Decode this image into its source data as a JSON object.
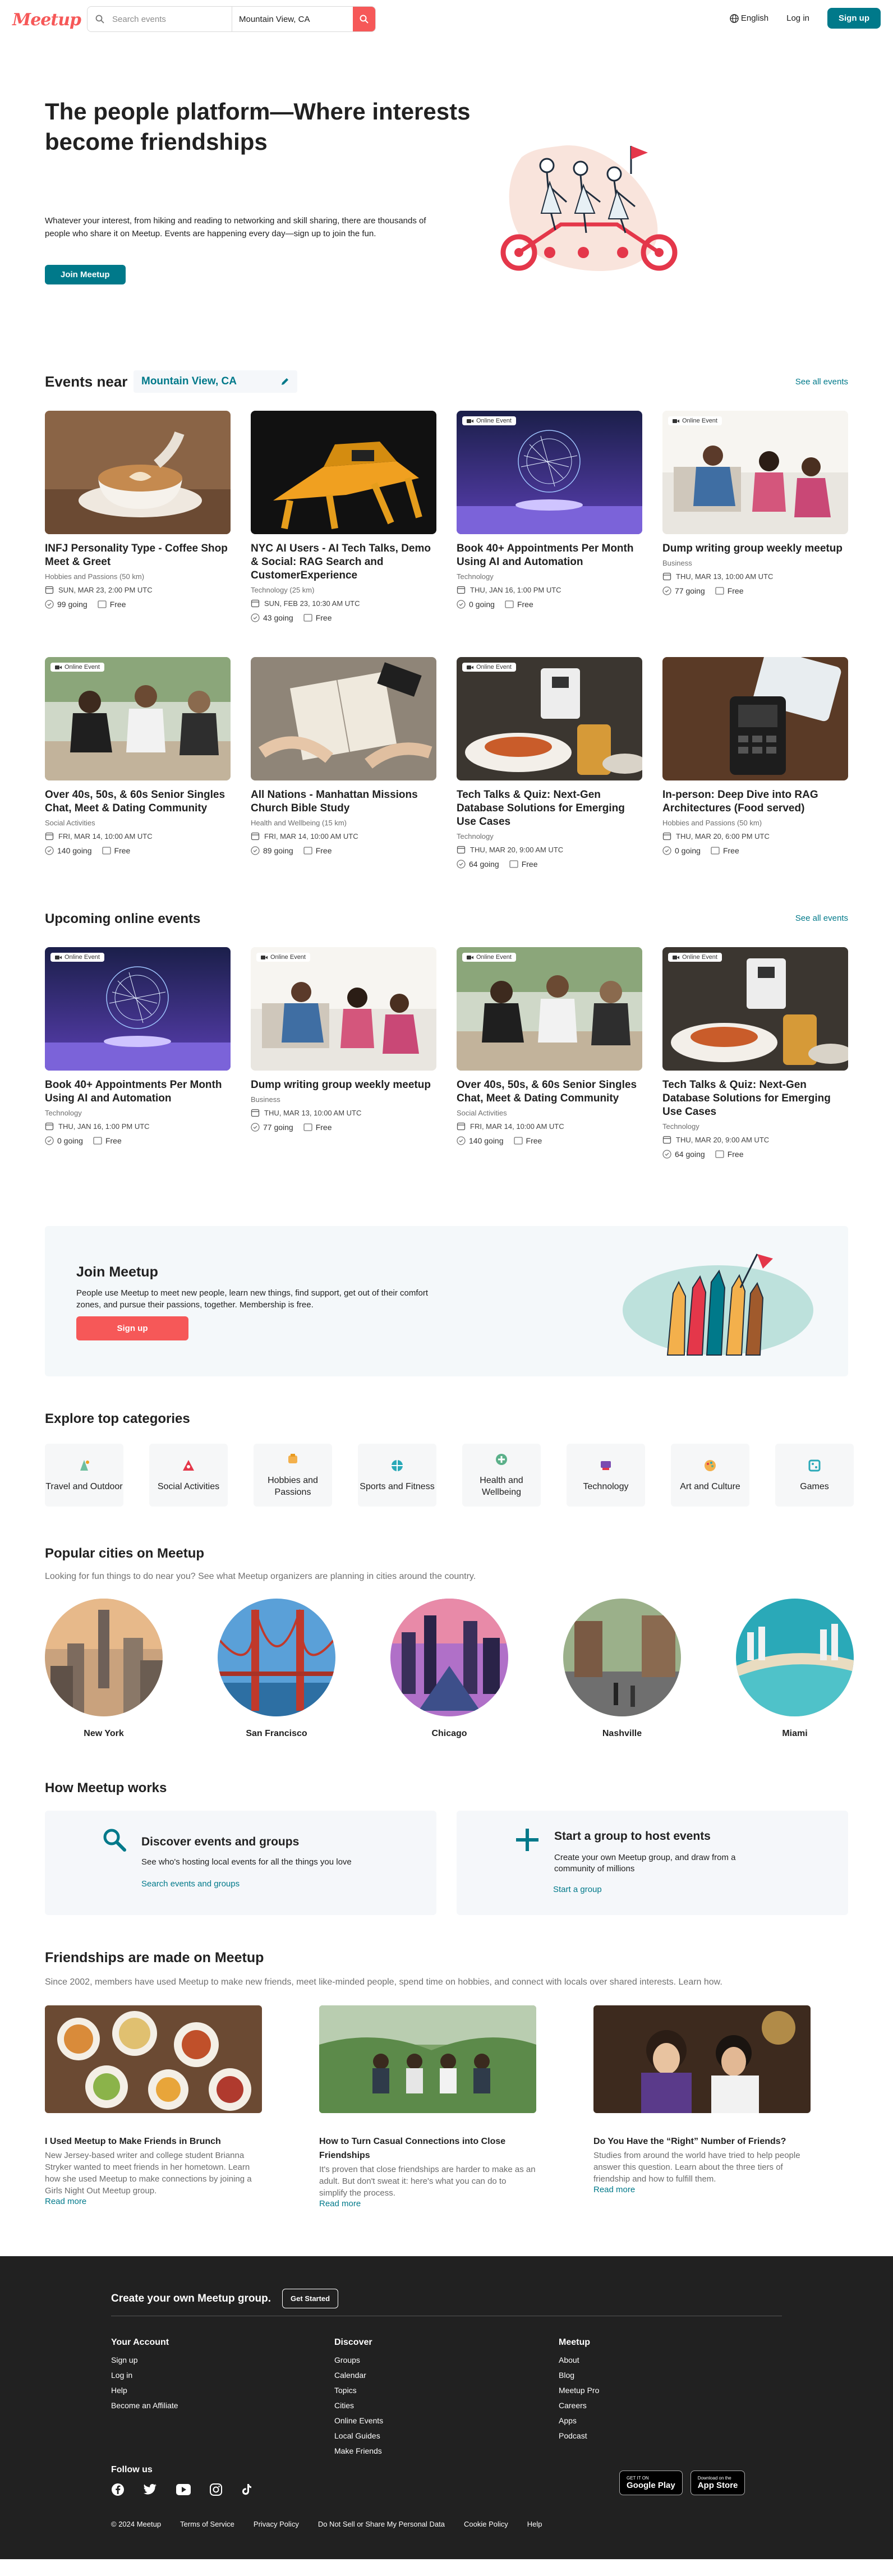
{
  "brand": {
    "logo": "Meetup",
    "accent": "#f65858",
    "teal": "#00798a"
  },
  "header": {
    "search_placeholder": "Search events",
    "location": "Mountain View, CA",
    "language": "English",
    "login": "Log in",
    "signup": "Sign up"
  },
  "hero": {
    "title": "The people platform—Where interests become friendships",
    "body": "Whatever your interest, from hiking and reading to networking and skill sharing, there are thousands of people who share it on Meetup. Events are happening every day—sign up to join the fun.",
    "cta": "Join Meetup"
  },
  "events_near": {
    "title": "Events near",
    "location": "Mountain View, CA",
    "see_all": "See all events",
    "online_badge": "Online Event",
    "items": [
      {
        "title": "INFJ Personality Type - Coffee Shop Meet & Greet",
        "group": "Hobbies and Passions (50 km)",
        "when": "SUN, MAR 23, 2:00 PM UTC",
        "going": "99 going",
        "price": "Free",
        "online": false,
        "img": "coffee"
      },
      {
        "title": "NYC AI Users - AI Tech Talks, Demo & Social: RAG Search and CustomerExperience",
        "group": "Technology (25 km)",
        "when": "SUN, FEB 23, 10:30 AM UTC",
        "going": "43 going",
        "price": "Free",
        "online": false,
        "img": "robot"
      },
      {
        "title": "Book 40+ Appointments Per Month Using AI and Automation",
        "group": "Technology",
        "when": "THU, JAN 16, 1:00 PM UTC",
        "going": "0 going",
        "price": "Free",
        "online": true,
        "img": "ai"
      },
      {
        "title": "Dump writing group weekly meetup",
        "group": "Business",
        "when": "THU, MAR 13, 10:00 AM UTC",
        "going": "77 going",
        "price": "Free",
        "online": true,
        "img": "writing"
      },
      {
        "title": "Over 40s, 50s, & 60s Senior Singles Chat, Meet & Dating Community",
        "group": "Social Activities",
        "when": "FRI, MAR 14, 10:00 AM UTC",
        "going": "140 going",
        "price": "Free",
        "online": true,
        "img": "cafe"
      },
      {
        "title": "All Nations - Manhattan Missions Church Bible Study",
        "group": "Health and Wellbeing (15 km)",
        "when": "FRI, MAR 14, 10:00 AM UTC",
        "going": "89 going",
        "price": "Free",
        "online": false,
        "img": "bible"
      },
      {
        "title": "Tech Talks & Quiz: Next-Gen Database Solutions for Emerging Use Cases",
        "group": "Technology",
        "when": "THU, MAR 20, 9:00 AM UTC",
        "going": "64 going",
        "price": "Free",
        "online": true,
        "img": "food"
      },
      {
        "title": "In-person: Deep Dive into RAG Architectures (Food served)",
        "group": "Hobbies and Passions (50 km)",
        "when": "THU, MAR 20, 6:00 PM UTC",
        "going": "0 going",
        "price": "Free",
        "online": false,
        "img": "pos"
      }
    ]
  },
  "upcoming_online": {
    "title": "Upcoming online events",
    "see_all": "See all events",
    "items": [
      {
        "title": "Book 40+ Appointments Per Month Using AI and Automation",
        "group": "Technology",
        "when": "THU, JAN 16, 1:00 PM UTC",
        "going": "0 going",
        "price": "Free",
        "online": true,
        "img": "ai"
      },
      {
        "title": "Dump writing group weekly meetup",
        "group": "Business",
        "when": "THU, MAR 13, 10:00 AM UTC",
        "going": "77 going",
        "price": "Free",
        "online": true,
        "img": "writing"
      },
      {
        "title": "Over 40s, 50s, & 60s Senior Singles Chat, Meet & Dating Community",
        "group": "Social Activities",
        "when": "FRI, MAR 14, 10:00 AM UTC",
        "going": "140 going",
        "price": "Free",
        "online": true,
        "img": "cafe"
      },
      {
        "title": "Tech Talks & Quiz: Next-Gen Database Solutions for Emerging Use Cases",
        "group": "Technology",
        "when": "THU, MAR 20, 9:00 AM UTC",
        "going": "64 going",
        "price": "Free",
        "online": true,
        "img": "food"
      }
    ]
  },
  "join_banner": {
    "title": "Join Meetup",
    "body": "People use Meetup to meet new people, learn new things, find support, get out of their comfort zones, and pursue their passions, together. Membership is free.",
    "cta": "Sign up"
  },
  "categories": {
    "title": "Explore top categories",
    "items": [
      {
        "label": "Travel and Outdoor",
        "icon": "travel-icon"
      },
      {
        "label": "Social Activities",
        "icon": "social-icon"
      },
      {
        "label": "Hobbies and Passions",
        "icon": "hobbies-icon"
      },
      {
        "label": "Sports and Fitness",
        "icon": "sports-icon"
      },
      {
        "label": "Health and Wellbeing",
        "icon": "health-icon"
      },
      {
        "label": "Technology",
        "icon": "technology-icon"
      },
      {
        "label": "Art and Culture",
        "icon": "art-icon"
      },
      {
        "label": "Games",
        "icon": "games-icon"
      }
    ]
  },
  "cities": {
    "title": "Popular cities on Meetup",
    "subtitle": "Looking for fun things to do near you? See what Meetup organizers are planning in cities around the country.",
    "items": [
      {
        "name": "New York"
      },
      {
        "name": "San Francisco"
      },
      {
        "name": "Chicago"
      },
      {
        "name": "Nashville"
      },
      {
        "name": "Miami"
      }
    ]
  },
  "how": {
    "title": "How Meetup works",
    "cards": [
      {
        "title": "Discover events and groups",
        "body": "See who's hosting local events for all the things you love",
        "link": "Search events and groups"
      },
      {
        "title": "Start a group to host events",
        "body": "Create your own Meetup group, and draw from a community of millions",
        "link": "Start a group"
      }
    ]
  },
  "friendships": {
    "title": "Friendships are made on Meetup",
    "subtitle": "Since 2002, members have used Meetup to make new friends, meet like-minded people, spend time on hobbies, and connect with locals over shared interests. Learn how.",
    "read_more": "Read more",
    "articles": [
      {
        "title": "I Used Meetup to Make Friends in Brunch",
        "body": "New Jersey-based writer and college student Brianna Stryker wanted to meet friends in her hometown. Learn how she used Meetup to make connections by joining a Girls Night Out Meetup group."
      },
      {
        "title": "How to Turn Casual Connections into Close Friendships",
        "body": "It's proven that close friendships are harder to make as an adult. But don't sweat it: here's what you can do to simplify the process."
      },
      {
        "title": "Do You Have the “Right” Number of Friends?",
        "body": "Studies from around the world have tried to help people answer this question. Learn about the three tiers of friendship and how to fulfill them."
      }
    ]
  },
  "footer": {
    "create": "Create your own Meetup group.",
    "get_started": "Get Started",
    "columns": [
      {
        "title": "Your Account",
        "links": [
          "Sign up",
          "Log in",
          "Help",
          "Become an Affiliate"
        ]
      },
      {
        "title": "Discover",
        "links": [
          "Groups",
          "Calendar",
          "Topics",
          "Cities",
          "Online Events",
          "Local Guides",
          "Make Friends"
        ]
      },
      {
        "title": "Meetup",
        "links": [
          "About",
          "Blog",
          "Meetup Pro",
          "Careers",
          "Apps",
          "Podcast"
        ]
      }
    ],
    "follow": "Follow us",
    "google_play_small": "GET IT ON",
    "google_play": "Google Play",
    "app_store_small": "Download on the",
    "app_store": "App Store",
    "bottom": [
      "© 2024 Meetup",
      "Terms of Service",
      "Privacy Policy",
      "Do Not Sell or Share My Personal Data",
      "Cookie Policy",
      "Help"
    ]
  }
}
